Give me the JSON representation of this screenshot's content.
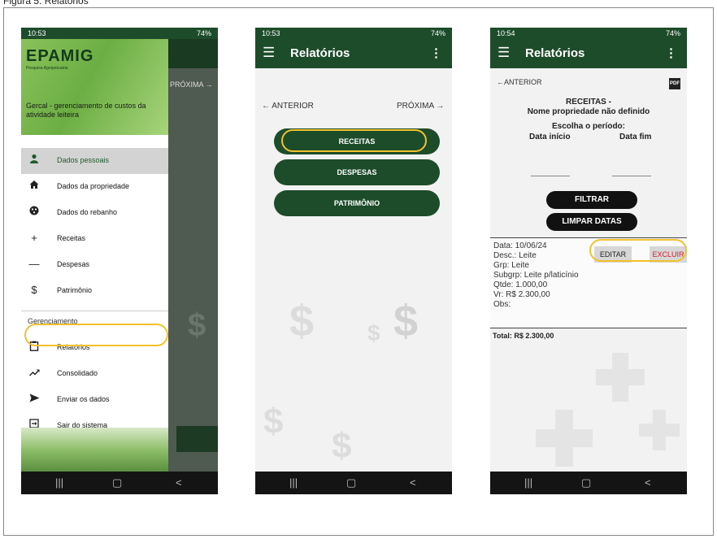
{
  "caption": "Figura 5. Relatórios",
  "phone1": {
    "status_time": "10:53",
    "status_right": "74%",
    "logo_text": "EPAMIG",
    "logo_sub": "Pesquisa Agropecuária",
    "app_description": "Gercal - gerenciamento de custos da atividade leiteira",
    "background_next": "PRÓXIMA",
    "menu_items": [
      {
        "label": "Dados pessoais",
        "icon": "person-icon"
      },
      {
        "label": "Dados da propriedade",
        "icon": "home-icon"
      },
      {
        "label": "Dados do rebanho",
        "icon": "herd-icon"
      },
      {
        "label": "Receitas",
        "icon": "plus-icon"
      },
      {
        "label": "Despesas",
        "icon": "minus-icon"
      },
      {
        "label": "Patrimônio",
        "icon": "dollar-icon"
      }
    ],
    "section_label": "Gerenciamento",
    "section_items": [
      {
        "label": "Relatórios",
        "icon": "clipboard-icon"
      },
      {
        "label": "Consolidado",
        "icon": "trend-icon"
      },
      {
        "label": "Enviar os dados",
        "icon": "send-icon"
      },
      {
        "label": "Sair do sistema",
        "icon": "exit-icon"
      }
    ],
    "nav": [
      "|||",
      "▢",
      "<"
    ]
  },
  "phone2": {
    "status_time": "10:53",
    "status_right": "74%",
    "title": "Relatórios",
    "prev": "ANTERIOR",
    "next": "PRÓXIMA",
    "buttons": [
      "RECEITAS",
      "DESPESAS",
      "PATRIMÔNIO"
    ],
    "nav": [
      "|||",
      "▢",
      "<"
    ]
  },
  "phone3": {
    "status_time": "10:54",
    "status_right": "74%",
    "title": "Relatórios",
    "prev": "ANTERIOR",
    "pdf_label": "PDF",
    "heading": "RECEITAS -",
    "subheading": "Nome propriedade não definido",
    "period_label": "Escolha o período:",
    "start_label": "Data início",
    "end_label": "Data fim",
    "filter_button": "FILTRAR",
    "clear_button": "LIMPAR DATAS",
    "record": {
      "data": "Data: 10/06/24",
      "desc": "Desc.: Leite",
      "grp": "Grp: Leite",
      "subgrp": "Subgrp: Leite p/laticínio",
      "qtde": "Qtde: 1.000,00",
      "vr": "Vr: R$ 2.300,00",
      "obs": "Obs:"
    },
    "edit_button": "EDITAR",
    "delete_button": "EXCLUIR",
    "total": "Total: R$ 2.300,00",
    "nav": [
      "|||",
      "▢",
      "<"
    ]
  },
  "colors": {
    "brand_green": "#1d4c2a",
    "highlight": "#f2c12e",
    "delete_red": "#d0202a"
  }
}
